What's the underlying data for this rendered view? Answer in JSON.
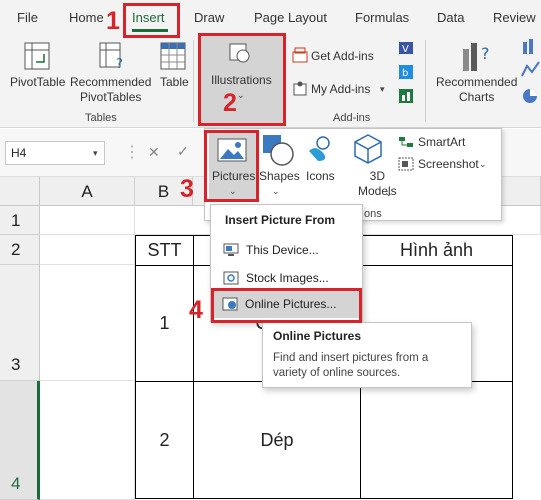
{
  "tabs": [
    "File",
    "Home",
    "Insert",
    "Draw",
    "Page Layout",
    "Formulas",
    "Data",
    "Review"
  ],
  "ribbon": {
    "pivottable": "PivotTable",
    "recommended_pivottables_1": "Recommended",
    "recommended_pivottables_2": "PivotTables",
    "table": "Table",
    "tables_group": "Tables",
    "illustrations": "Illustrations",
    "get_addins": "Get Add-ins",
    "my_addins": "My Add-ins",
    "addins_group": "Add-ins",
    "recommended_charts_1": "Recommended",
    "recommended_charts_2": "Charts"
  },
  "formula_bar": {
    "name_box": "H4",
    "cancel": "✕",
    "enter": "✓"
  },
  "columns": [
    "A",
    "B"
  ],
  "rows": [
    "1",
    "2",
    "3",
    "4"
  ],
  "table": {
    "header_stt": "STT",
    "header_image": "Hình ảnh",
    "row3_stt": "1",
    "row3_partial": "C",
    "row4_stt": "2",
    "row4_name": "Dép"
  },
  "illustrations_panel": {
    "pictures_1": "Pictures",
    "shapes": "Shapes",
    "icons": "Icons",
    "models_1": "3D",
    "models_2": "Models",
    "smartart": "SmartArt",
    "screenshot": "Screenshot",
    "group_label": "ons"
  },
  "picture_menu": {
    "heading": "Insert Picture From",
    "this_device": "This Device...",
    "stock_images": "Stock Images...",
    "online_pictures": "Online Pictures..."
  },
  "tooltip": {
    "title": "Online Pictures",
    "body": "Find and insert pictures from a variety of online sources."
  },
  "steps": [
    "1",
    "2",
    "3",
    "4"
  ],
  "colors": {
    "excel_green": "#1e6b3a",
    "annotation_red": "#d8232a"
  }
}
